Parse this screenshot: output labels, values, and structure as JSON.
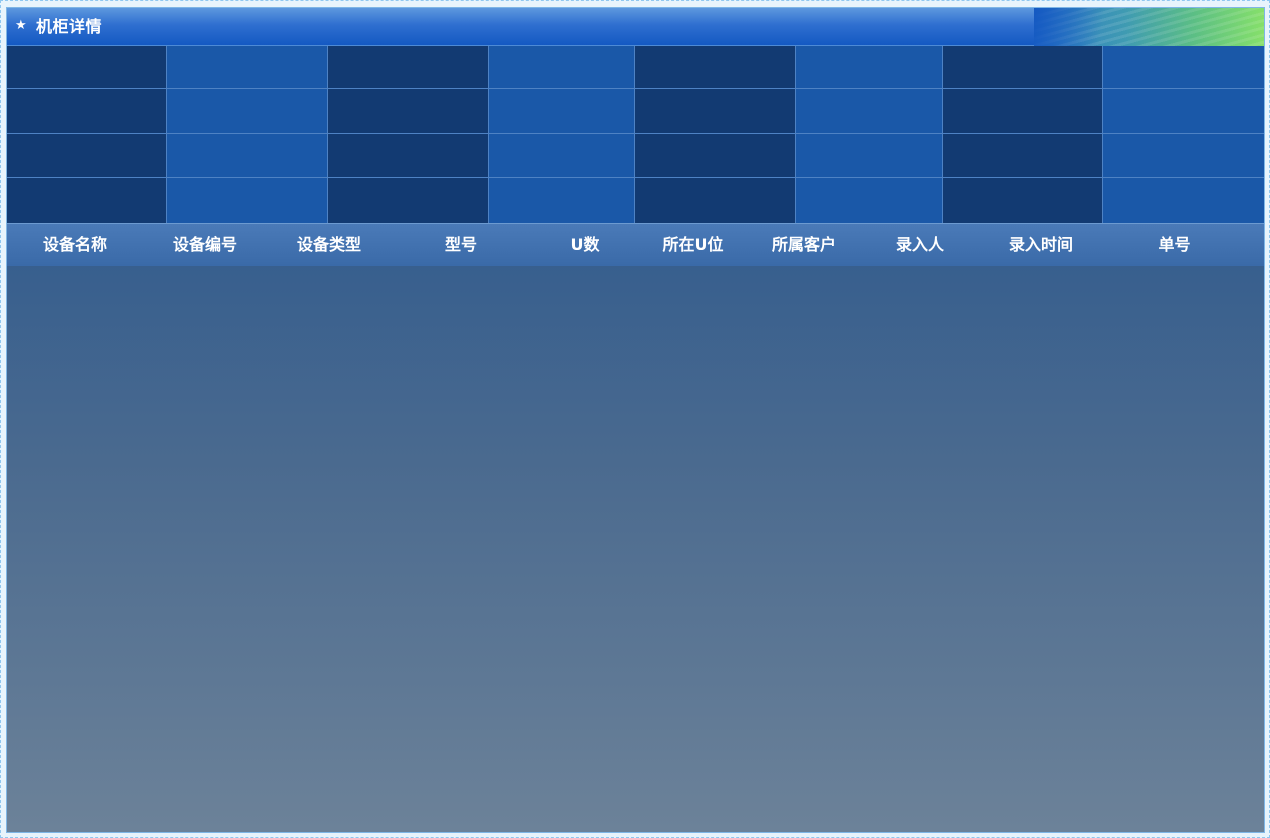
{
  "panel": {
    "title": "机柜详情",
    "title_icon": "star-icon"
  },
  "info_grid": {
    "rows": 4,
    "columns": 8
  },
  "table": {
    "columns": [
      "设备名称",
      "设备编号",
      "设备类型",
      "型号",
      "U数",
      "所在U位",
      "所属客户",
      "录入人",
      "录入时间",
      "单号"
    ],
    "rows": []
  },
  "colors": {
    "title_bar": "#1459c2",
    "label_cell": "#123a72",
    "value_cell": "#1a58a8",
    "header_bg": "#3a6aa8"
  }
}
